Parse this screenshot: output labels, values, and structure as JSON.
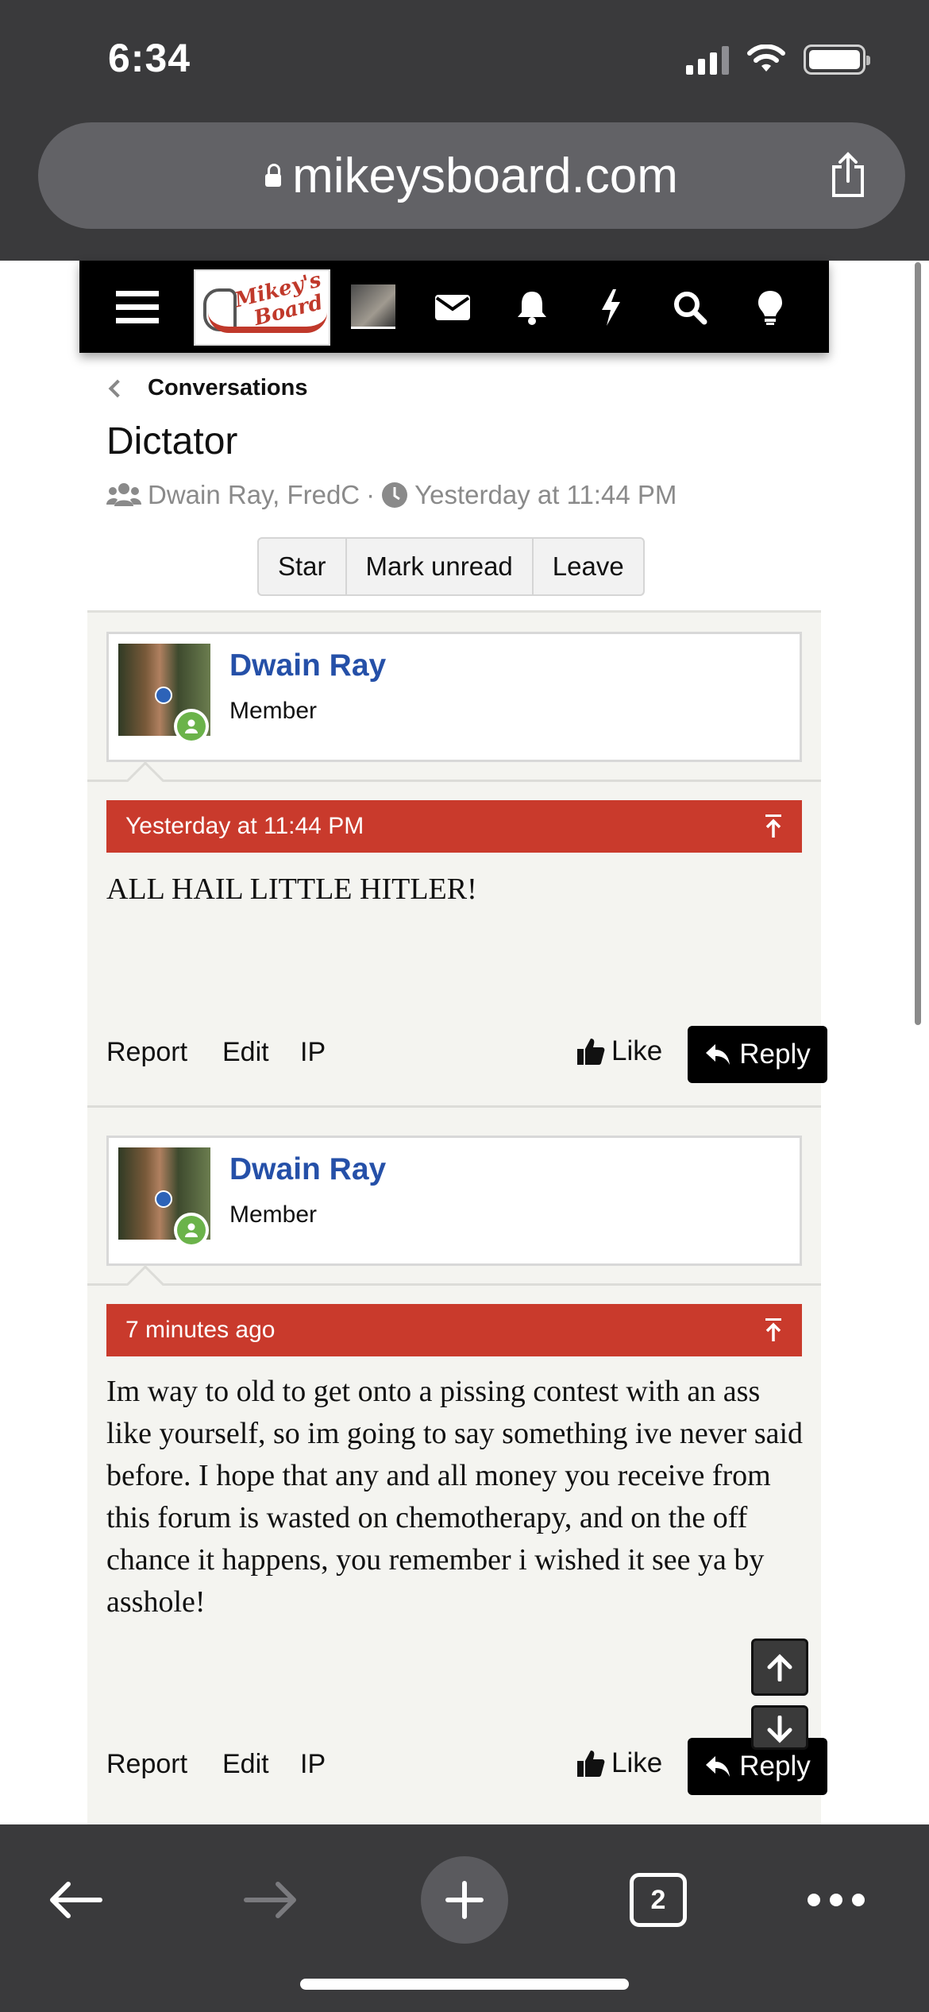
{
  "status": {
    "time": "6:34"
  },
  "browser": {
    "url": "mikeysboard.com",
    "tabs_count": "2"
  },
  "site": {
    "logo_text": "Mikey's Board",
    "nav_icons": [
      "menu-icon",
      "logo",
      "user-avatar",
      "envelope-icon",
      "bell-icon",
      "bolt-icon",
      "search-icon",
      "lightbulb-icon"
    ]
  },
  "conversation": {
    "breadcrumb": "Conversations",
    "title": "Dictator",
    "participants": "Dwain Ray, FredC",
    "separator": "·",
    "started": "Yesterday at 11:44 PM",
    "buttons": {
      "star": "Star",
      "mark_unread": "Mark unread",
      "leave": "Leave"
    }
  },
  "messages": [
    {
      "author": "Dwain Ray",
      "role": "Member",
      "date": "Yesterday at 11:44 PM",
      "text": "ALL HAIL LITTLE HITLER!",
      "actions": {
        "report": "Report",
        "edit": "Edit",
        "ip": "IP",
        "like": "Like",
        "reply": "Reply"
      }
    },
    {
      "author": "Dwain Ray",
      "role": "Member",
      "date": "7 minutes ago",
      "text": "Im way to old to get onto a pissing contest with an ass like yourself, so im going to say something ive never said before. I hope that any and all money you receive from this forum is wasted on chemotherapy, and on the off chance it happens, you remember i wished it see ya by asshole!",
      "actions": {
        "report": "Report",
        "edit": "Edit",
        "ip": "IP",
        "like": "Like",
        "reply": "Reply"
      }
    }
  ],
  "colors": {
    "accent_red": "#c93a2c",
    "link_blue": "#2550a8",
    "chrome": "#3a3a3c"
  }
}
